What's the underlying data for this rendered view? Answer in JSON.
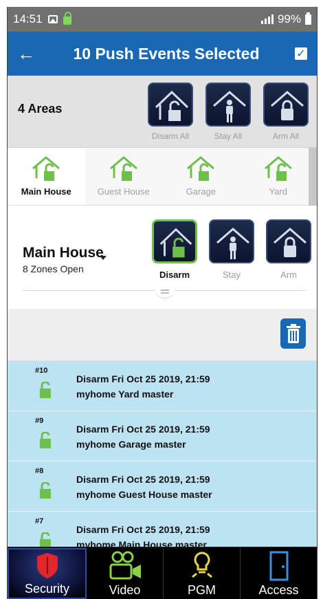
{
  "status": {
    "time": "14:51",
    "battery": "99%"
  },
  "appbar": {
    "back_icon": "arrow-left-icon",
    "title": "10 Push Events Selected",
    "select_all_icon": "checkbox-checked-icon"
  },
  "areas": {
    "label": "4 Areas",
    "actions": [
      {
        "label": "Disarm All",
        "icon": "house-disarm-icon"
      },
      {
        "label": "Stay All",
        "icon": "house-stay-icon"
      },
      {
        "label": "Arm All",
        "icon": "house-arm-icon"
      }
    ]
  },
  "tabs": [
    {
      "label": "Main House",
      "active": true
    },
    {
      "label": "Guest House",
      "active": false
    },
    {
      "label": "Garage",
      "active": false
    },
    {
      "label": "Yard",
      "active": false
    }
  ],
  "area_detail": {
    "name": "Main House",
    "zones": "8 Zones Open",
    "actions": [
      {
        "label": "Disarm",
        "selected": true
      },
      {
        "label": "Stay",
        "selected": false
      },
      {
        "label": "Arm",
        "selected": false
      }
    ]
  },
  "toolbar": {
    "delete_icon": "trash-icon"
  },
  "events": [
    {
      "num": "#10",
      "line1": "Disarm Fri Oct 25 2019, 21:59",
      "line2": "myhome Yard master"
    },
    {
      "num": "#9",
      "line1": "Disarm Fri Oct 25 2019, 21:59",
      "line2": "myhome Garage master"
    },
    {
      "num": "#8",
      "line1": "Disarm Fri Oct 25 2019, 21:59",
      "line2": "myhome Guest House master"
    },
    {
      "num": "#7",
      "line1": "Disarm Fri Oct 25 2019, 21:59",
      "line2": "myhome Main House master"
    }
  ],
  "nav": [
    {
      "label": "Security",
      "icon": "shield-icon",
      "active": true
    },
    {
      "label": "Video",
      "icon": "video-camera-icon",
      "active": false
    },
    {
      "label": "PGM",
      "icon": "lightbulb-icon",
      "active": false
    },
    {
      "label": "Access",
      "icon": "door-icon",
      "active": false
    }
  ],
  "colors": {
    "primary": "#1868b3",
    "accent_green": "#6fbf4b",
    "event_bg": "#bde2f2",
    "tile_dark": "#0c1530"
  }
}
